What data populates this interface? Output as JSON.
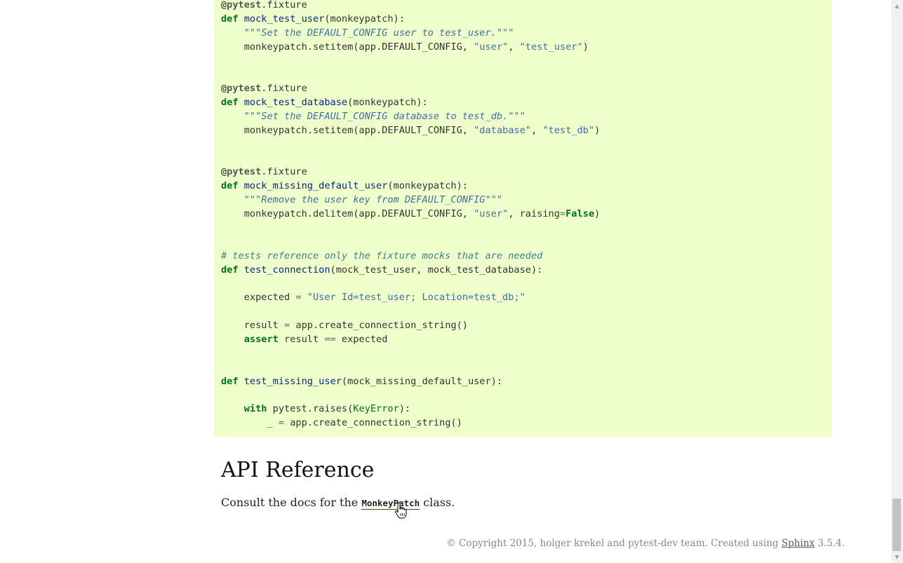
{
  "code": {
    "l1_decorator": "@pytest",
    "l1_rest": ".fixture",
    "l2_def": "def",
    "l2_name": "mock_test_user",
    "l2_args": "(monkeypatch):",
    "l3_doc": "\"\"\"Set the DEFAULT_CONFIG user to test_user.\"\"\"",
    "l4_a": "monkeypatch.setitem(app.DEFAULT_CONFIG, ",
    "l4_s1": "\"user\"",
    "l4_b": ", ",
    "l4_s2": "\"test_user\"",
    "l4_c": ")",
    "l5_decorator": "@pytest",
    "l5_rest": ".fixture",
    "l6_def": "def",
    "l6_name": "mock_test_database",
    "l6_args": "(monkeypatch):",
    "l7_doc": "\"\"\"Set the DEFAULT_CONFIG database to test_db.\"\"\"",
    "l8_a": "monkeypatch.setitem(app.DEFAULT_CONFIG, ",
    "l8_s1": "\"database\"",
    "l8_b": ", ",
    "l8_s2": "\"test_db\"",
    "l8_c": ")",
    "l9_decorator": "@pytest",
    "l9_rest": ".fixture",
    "l10_def": "def",
    "l10_name": "mock_missing_default_user",
    "l10_args": "(monkeypatch):",
    "l11_doc": "\"\"\"Remove the user key from DEFAULT_CONFIG\"\"\"",
    "l12_a": "monkeypatch.delitem(app.DEFAULT_CONFIG, ",
    "l12_s1": "\"user\"",
    "l12_b": ", raising",
    "l12_eq": "=",
    "l12_kw": "False",
    "l12_c": ")",
    "l13_comment": "# tests reference only the fixture mocks that are needed",
    "l14_def": "def",
    "l14_name": "test_connection",
    "l14_args": "(mock_test_user, mock_test_database):",
    "l15_a": "expected ",
    "l15_eq": "=",
    "l15_b": " ",
    "l15_s": "\"User Id=test_user; Location=test_db;\"",
    "l16_a": "result ",
    "l16_eq": "=",
    "l16_b": " app.create_connection_string()",
    "l17_kw": "assert",
    "l17_a": " result ",
    "l17_eq": "==",
    "l17_b": " expected",
    "l18_def": "def",
    "l18_name": "test_missing_user",
    "l18_args": "(mock_missing_default_user):",
    "l19_kw": "with",
    "l19_a": " pytest.raises(",
    "l19_exc": "KeyError",
    "l19_b": "):",
    "l20_a": "_ ",
    "l20_eq": "=",
    "l20_b": " app.create_connection_string()"
  },
  "section": {
    "title": "API Reference",
    "text_before": "Consult the docs for the ",
    "link": "MonkeyPatch",
    "text_after": " class."
  },
  "footer": {
    "copyright": "© Copyright 2015, holger krekel and pytest-dev team. Created using ",
    "sphinx_link": "Sphinx",
    "version": " 3.5.4."
  },
  "icons": {
    "scroll_up": "scroll-up-arrow-icon",
    "scroll_down": "scroll-down-arrow-icon",
    "cursor": "hand-pointer-cursor-icon"
  },
  "colors": {
    "code_background": "#eeffcc",
    "keyword": "#007020",
    "string": "#4070a0",
    "function": "#06287e",
    "comment": "#408090"
  }
}
